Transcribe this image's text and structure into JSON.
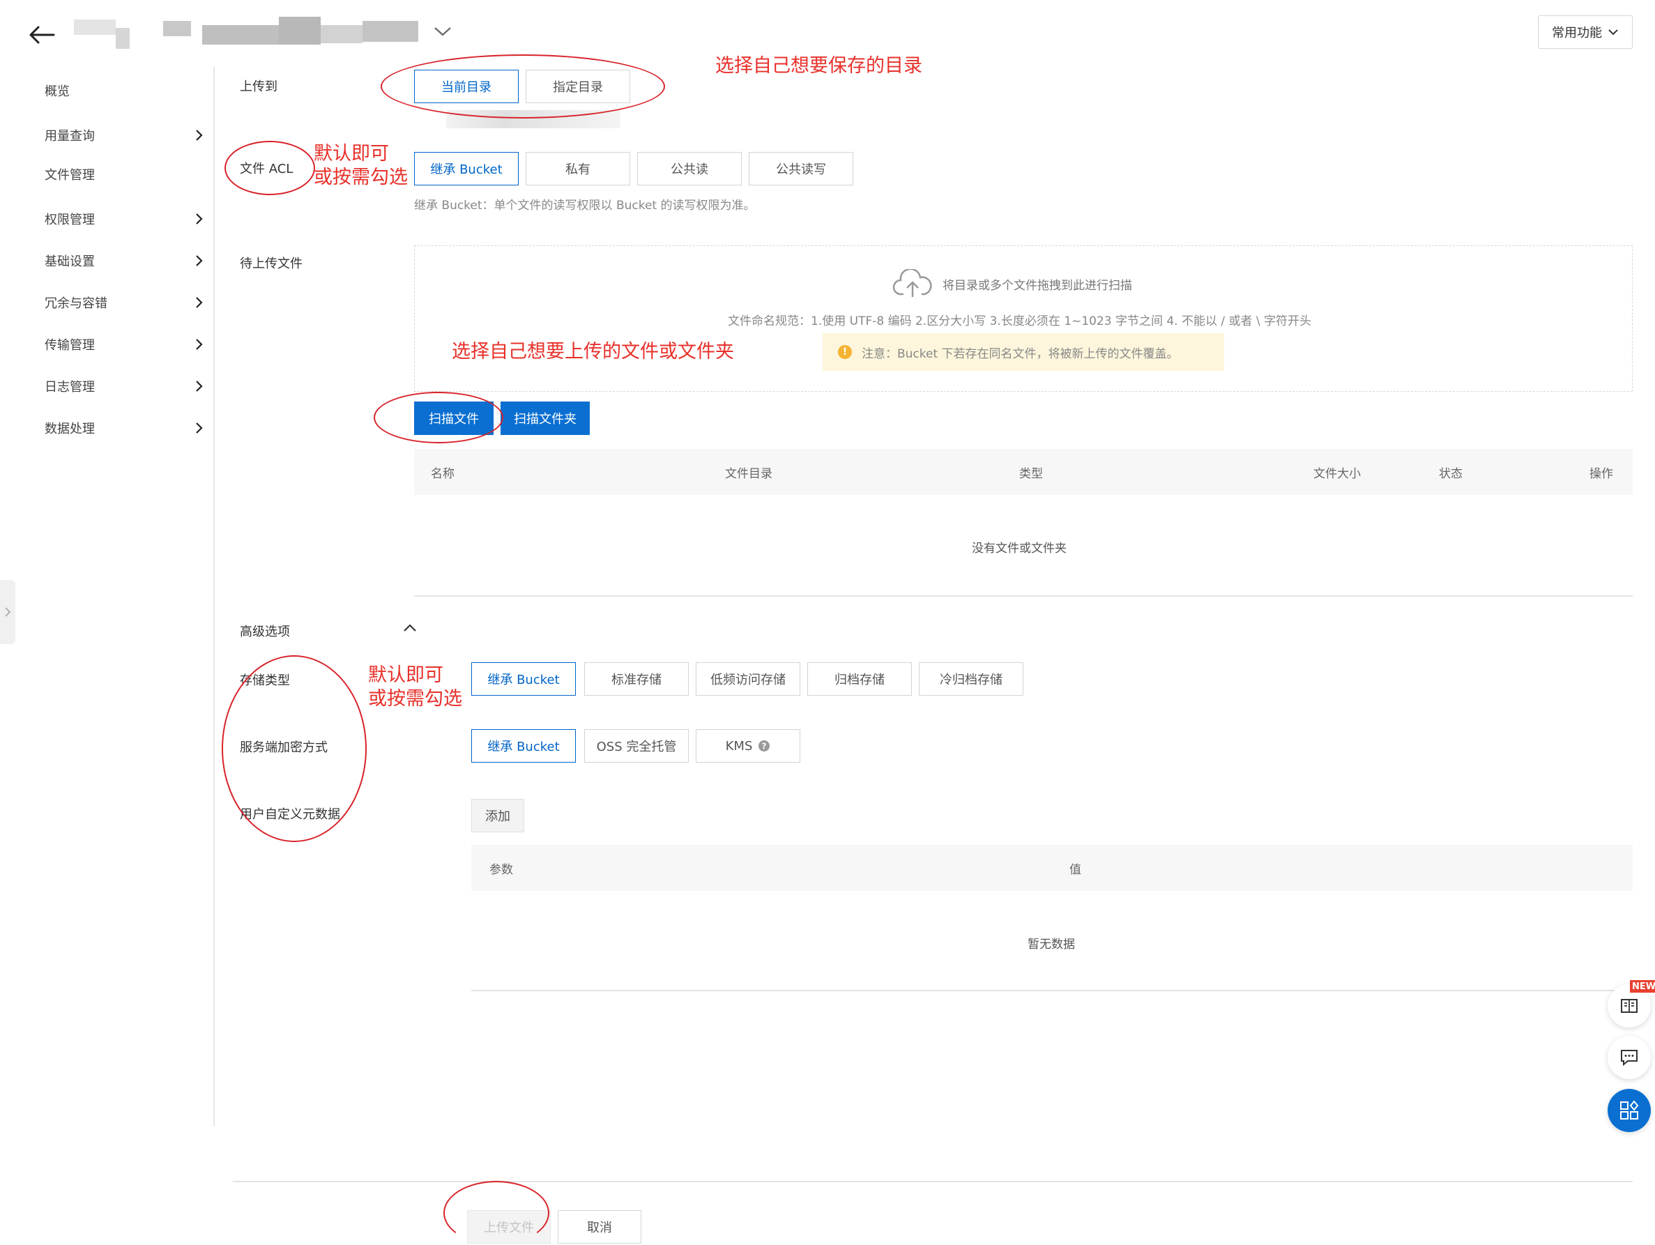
{
  "header": {
    "common_functions_label": "常用功能"
  },
  "sidebar": {
    "items": [
      {
        "label": "概览",
        "has_submenu": false
      },
      {
        "label": "用量查询",
        "has_submenu": true
      },
      {
        "label": "文件管理",
        "has_submenu": false
      },
      {
        "label": "权限管理",
        "has_submenu": true
      },
      {
        "label": "基础设置",
        "has_submenu": true
      },
      {
        "label": "冗余与容错",
        "has_submenu": true
      },
      {
        "label": "传输管理",
        "has_submenu": true
      },
      {
        "label": "日志管理",
        "has_submenu": true
      },
      {
        "label": "数据处理",
        "has_submenu": true
      }
    ]
  },
  "form": {
    "upload_to": {
      "label": "上传到",
      "options": [
        "当前目录",
        "指定目录"
      ],
      "selected": "当前目录"
    },
    "acl": {
      "label": "文件 ACL",
      "options": [
        "继承 Bucket",
        "私有",
        "公共读",
        "公共读写"
      ],
      "selected": "继承 Bucket",
      "hint": "继承 Bucket：单个文件的读写权限以 Bucket 的读写权限为准。"
    },
    "pending_files": {
      "label": "待上传文件",
      "drop_text": "将目录或多个文件拖拽到此进行扫描",
      "naming_rule": "文件命名规范：1.使用 UTF-8 编码 2.区分大小写 3.长度必须在 1~1023 字节之间 4. 不能以 / 或者 \\ 字符开头",
      "notice": "注意：Bucket 下若存在同名文件，将被新上传的文件覆盖。",
      "scan_file_button": "扫描文件",
      "scan_folder_button": "扫描文件夹",
      "table": {
        "columns": [
          "名称",
          "文件目录",
          "类型",
          "文件大小",
          "状态",
          "操作"
        ],
        "empty_text": "没有文件或文件夹"
      }
    },
    "advanced": {
      "label": "高级选项",
      "storage_class": {
        "label": "存储类型",
        "options": [
          "继承 Bucket",
          "标准存储",
          "低频访问存储",
          "归档存储",
          "冷归档存储"
        ],
        "selected": "继承 Bucket"
      },
      "encryption": {
        "label": "服务端加密方式",
        "options": [
          "继承 Bucket",
          "OSS 完全托管",
          "KMS"
        ],
        "selected": "继承 Bucket"
      },
      "metadata": {
        "label": "用户自定义元数据",
        "add_button": "添加",
        "columns": [
          "参数",
          "值"
        ],
        "empty_text": "暂无数据"
      }
    }
  },
  "footer": {
    "upload_button": "上传文件",
    "cancel_button": "取消"
  },
  "float_tools": {
    "new_badge": "NEW"
  },
  "annotations": {
    "upload_dir_note": "选择自己想要保存的目录",
    "acl_note_line1": "默认即可",
    "acl_note_line2": "或按需勾选",
    "file_select_note": "选择自己想要上传的文件或文件夹",
    "advanced_note_line1": "默认即可",
    "advanced_note_line2": "或按需勾选"
  },
  "colors": {
    "accent": "#0a6fd1",
    "annotation": "#e8302a",
    "notice_bg": "#fdf6dc"
  }
}
